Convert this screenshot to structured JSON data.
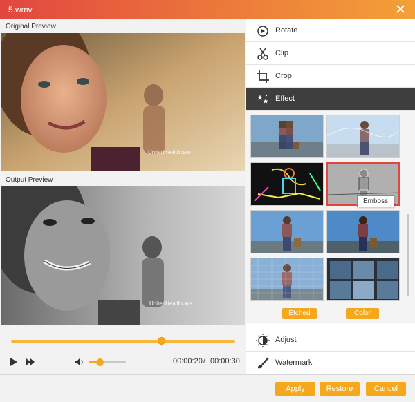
{
  "window": {
    "title": "5.wmv"
  },
  "left": {
    "original_label": "Original Preview",
    "output_label": "Output Preview",
    "watermark_text": "UnitedHealthcare",
    "timeline_progress": 0.67,
    "volume_level": 0.3,
    "current_time": "00:00:20",
    "time_separator": "/",
    "total_time": "00:00:30"
  },
  "menu": [
    {
      "label": "Rotate",
      "icon": "rotate-icon"
    },
    {
      "label": "Clip",
      "icon": "scissors-icon"
    },
    {
      "label": "Crop",
      "icon": "crop-icon"
    },
    {
      "label": "Effect",
      "icon": "stars-icon",
      "active": true
    },
    {
      "label": "Adjust",
      "icon": "contrast-icon"
    },
    {
      "label": "Watermark",
      "icon": "brush-icon"
    }
  ],
  "effects": {
    "tooltip": "Emboss",
    "thumbnails": [
      "pixelate",
      "sketch",
      "neon-edge",
      "emboss",
      "normal",
      "sharpen",
      "canvas",
      "tiles"
    ],
    "tags": [
      "Etched",
      "Color"
    ]
  },
  "footer": {
    "apply": "Apply",
    "restore": "Restore",
    "cancel": "Cancel"
  },
  "colors": {
    "accent": "#f6a81c",
    "title_start": "#e2463f",
    "title_end": "#f3a138",
    "active_menu": "#3e3e3e"
  }
}
